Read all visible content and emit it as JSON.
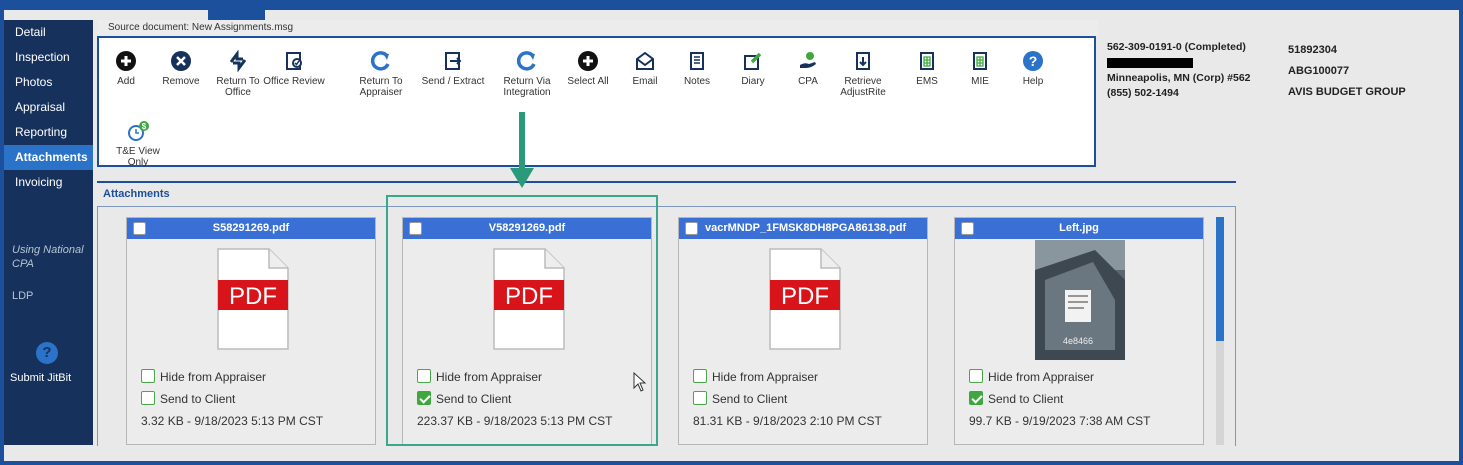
{
  "source_document": "Source document: New Assignments.msg",
  "sidebar": {
    "items": [
      {
        "label": "Detail"
      },
      {
        "label": "Inspection"
      },
      {
        "label": "Photos"
      },
      {
        "label": "Appraisal"
      },
      {
        "label": "Reporting"
      },
      {
        "label": "Attachments",
        "active": true
      },
      {
        "label": "Invoicing"
      }
    ],
    "note": "Using National CPA",
    "ldp": "LDP",
    "submit": "Submit JitBit"
  },
  "toolbar": {
    "add": "Add",
    "remove": "Remove",
    "return_office": "Return To Office",
    "office_review": "Office Review",
    "return_appraiser": "Return To Appraiser",
    "send_extract": "Send / Extract",
    "return_integration": "Return Via Integration",
    "select_all": "Select All",
    "email": "Email",
    "notes": "Notes",
    "diary": "Diary",
    "cpa": "CPA",
    "retrieve": "Retrieve AdjustRite",
    "ems": "EMS",
    "mie": "MIE",
    "help": "Help",
    "te_view": "T&E View Only"
  },
  "info": {
    "claim": "562-309-0191-0  (Completed)",
    "location": "Minneapolis, MN (Corp) #562",
    "phone": "(855) 502-1494",
    "id1": "51892304",
    "id2": "ABG100077",
    "company": "AVIS BUDGET GROUP"
  },
  "attachments_title": "Attachments",
  "options": {
    "hide": "Hide from Appraiser",
    "send": "Send to Client"
  },
  "cards": [
    {
      "filename": "S58291269.pdf",
      "type": "pdf",
      "hide": false,
      "send": false,
      "meta": "3.32 KB - 9/18/2023 5:13 PM CST"
    },
    {
      "filename": "V58291269.pdf",
      "type": "pdf",
      "hide": false,
      "send": true,
      "meta": "223.37 KB - 9/18/2023 5:13 PM CST"
    },
    {
      "filename": "vacrMNDP_1FMSK8DH8PGA86138.pdf",
      "type": "pdf",
      "hide": false,
      "send": false,
      "meta": "81.31 KB - 9/18/2023 2:10 PM CST"
    },
    {
      "filename": "Left.jpg",
      "type": "image",
      "hide": false,
      "send": true,
      "meta": "99.7 KB - 9/19/2023 7:38 AM CST"
    }
  ],
  "pdf_label": "PDF",
  "colors": {
    "nav_bg": "#16325c",
    "accent": "#2a73c8",
    "card_header": "#3a70d6",
    "highlight": "#3aa88a",
    "check_green": "#3ea83e",
    "pdf_red": "#d9131a"
  }
}
